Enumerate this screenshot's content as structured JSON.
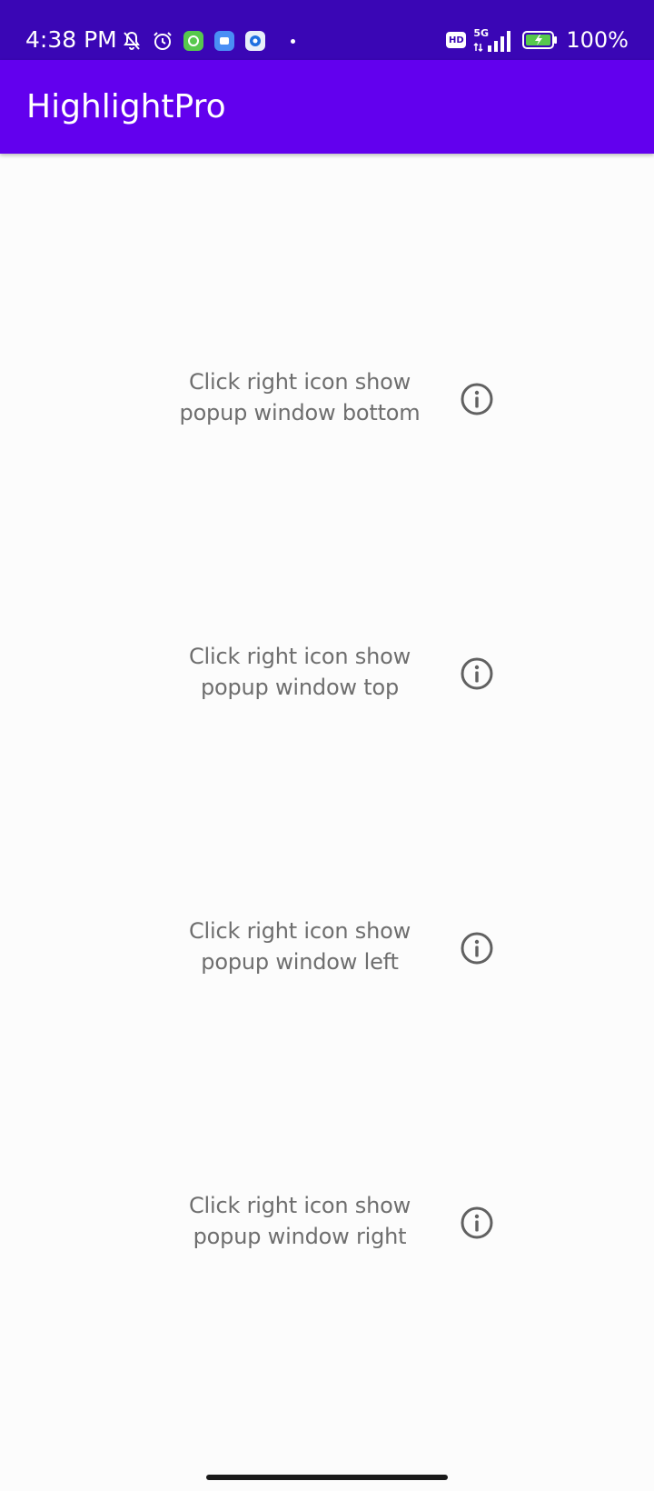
{
  "status_bar": {
    "time": "4:38 PM",
    "battery_percent": "100%",
    "network_label": "5G",
    "hd_label": "HD",
    "background": "#3a06b5",
    "icons": [
      "muted-bell-icon",
      "alarm-icon",
      "green-app-icon",
      "blue-app-icon",
      "browser-app-icon",
      "notification-dot-icon",
      "hd-icon",
      "signal-icon",
      "battery-charging-icon"
    ]
  },
  "app_bar": {
    "title": "HighlightPro",
    "background": "#6200ee"
  },
  "rows": [
    {
      "line1": "Click right icon show",
      "line2": "popup window bottom",
      "icon": "info-icon"
    },
    {
      "line1": "Click right icon show",
      "line2": "popup window top",
      "icon": "info-icon"
    },
    {
      "line1": "Click right icon show",
      "line2": "popup window left",
      "icon": "info-icon"
    },
    {
      "line1": "Click right icon show",
      "line2": "popup window right",
      "icon": "info-icon"
    }
  ],
  "colors": {
    "text": "#6e6e6e",
    "icon": "#616161",
    "page_background": "#fcfcfc"
  }
}
